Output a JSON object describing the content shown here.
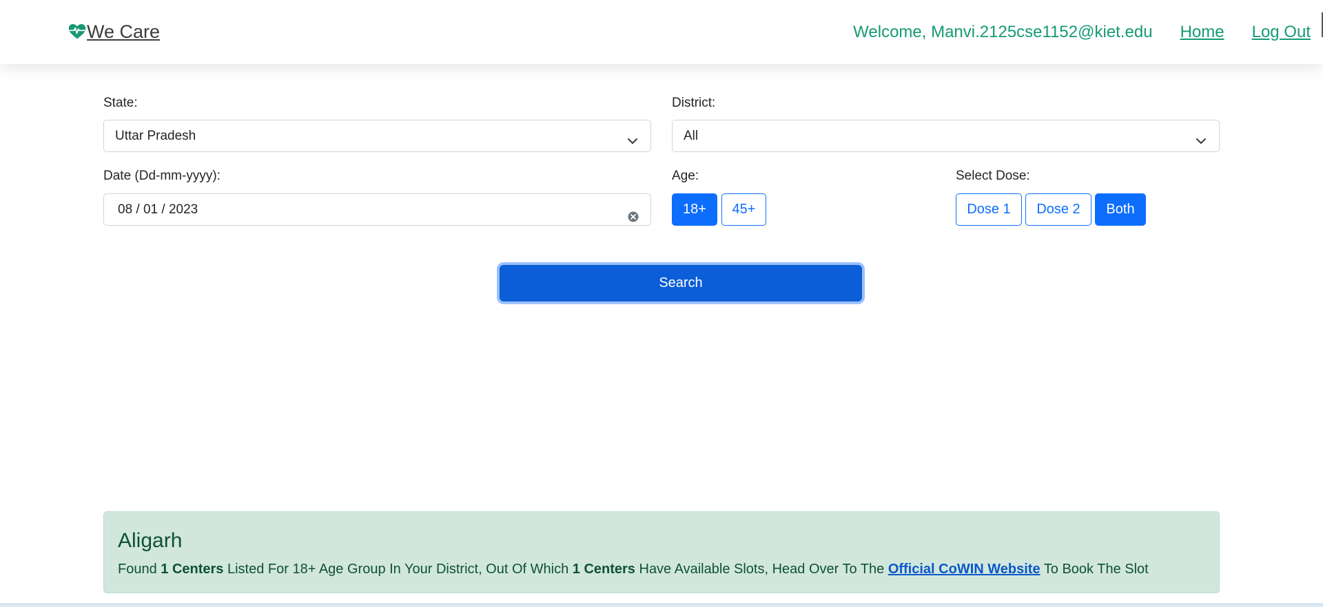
{
  "nav": {
    "brand": "We Care",
    "welcome": "Welcome, Manvi.2125cse1152@kiet.edu",
    "home": "Home",
    "logout": "Log Out"
  },
  "form": {
    "state_label": "State:",
    "state_value": "Uttar Pradesh",
    "district_label": "District:",
    "district_value": "All",
    "date_label": "Date (Dd-mm-yyyy):",
    "date_value": "08 / 01 / 2023",
    "age_label": "Age:",
    "age_options": [
      "18+",
      "45+"
    ],
    "age_selected": "18+",
    "dose_label": "Select Dose:",
    "dose_options": [
      "Dose 1",
      "Dose 2",
      "Both"
    ],
    "dose_selected": "Both",
    "search": "Search"
  },
  "result": {
    "district": "Aligarh",
    "found": "Found ",
    "centers_total": "1 Centers",
    "mid": " Listed For 18+ Age Group In Your District, Out Of Which ",
    "centers_available": "1 Centers",
    "tail": " Have Available Slots, Head Over To The ",
    "link": "Official CoWIN Website",
    "end": " To Book The Slot"
  },
  "colors": {
    "brand_green": "#159a74",
    "primary": "#0d6efd",
    "success_bg": "#d1e7dd",
    "success_text": "#0f5132"
  },
  "icons": {
    "brand": "heart-pulse-icon",
    "select": "chevron-down-icon",
    "date_clear": "clear-circle-icon"
  }
}
